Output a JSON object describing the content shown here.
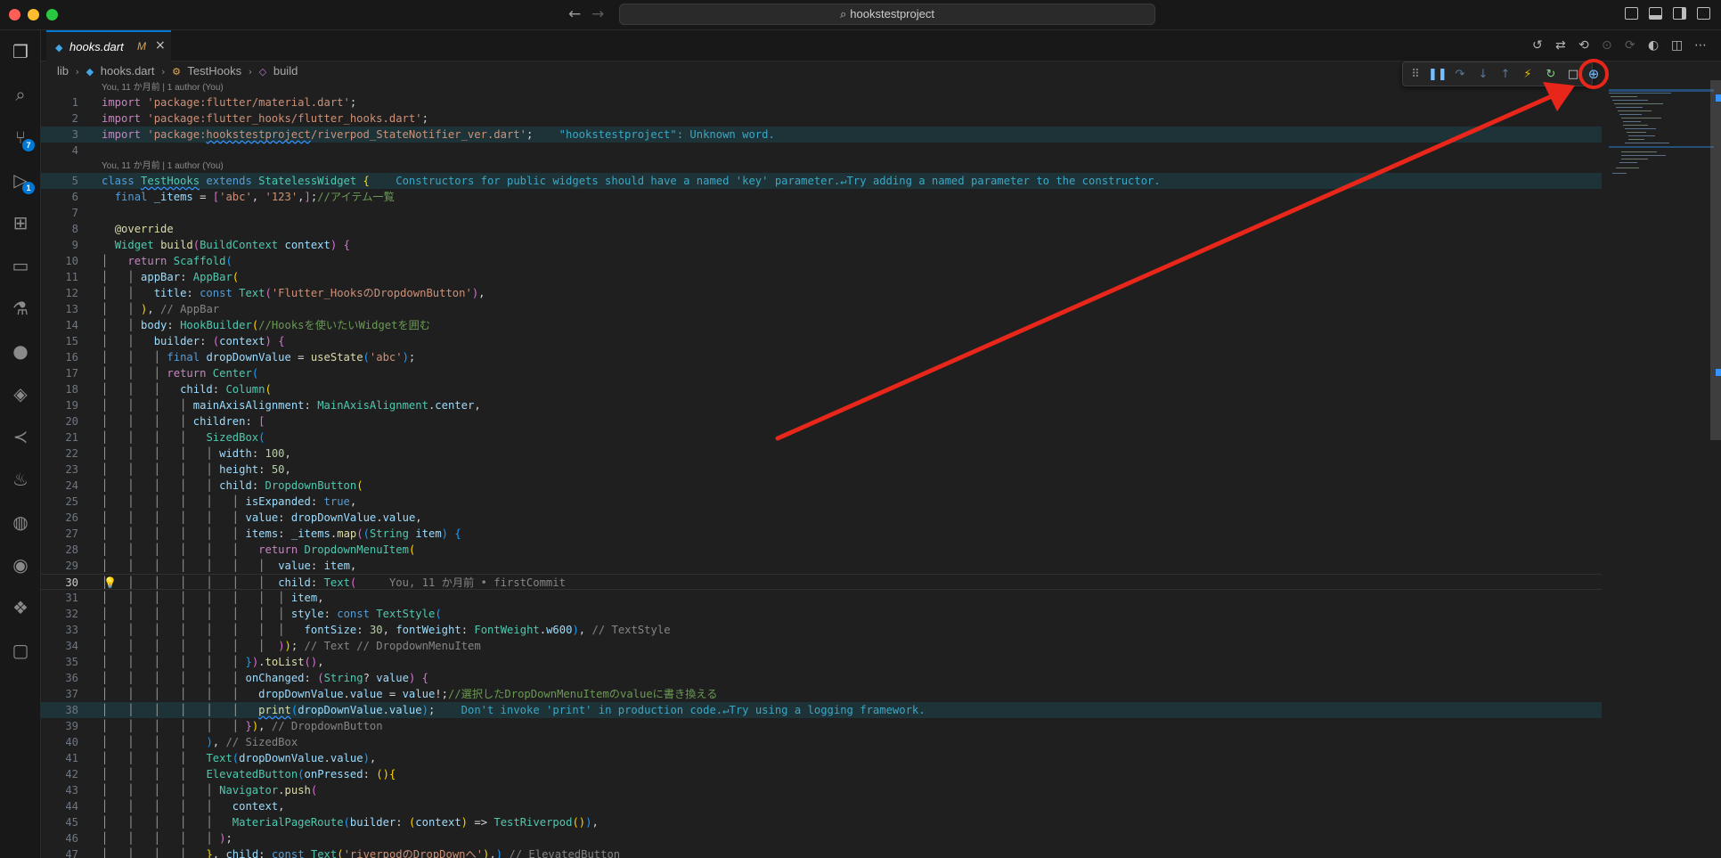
{
  "window": {
    "search_text": "hookstestproject"
  },
  "tab": {
    "label": "hooks.dart",
    "modified": "M"
  },
  "breadcrumb": [
    "lib",
    "hooks.dart",
    "TestHooks",
    "build"
  ],
  "blame": {
    "line1": "You, 11 か月前 | 1 author (You)",
    "line5": "You, 11 か月前 | 1 author (You)",
    "inline30": "You, 11 か月前 • firstCommit"
  },
  "diagnostics": {
    "line3": "\"hookstestproject\": Unknown word.",
    "line5": "Constructors for public widgets should have a named 'key' parameter.↵Try adding a named parameter to the constructor.",
    "line38": "Don't invoke 'print' in production code.↵Try using a logging framework."
  },
  "activity_badges": {
    "source_control": "7",
    "run_debug": "1"
  },
  "colors": {
    "accent": "#0078d4",
    "annotation_red": "#e8261a"
  },
  "icons": {
    "activity": [
      "explorer-icon",
      "search-icon",
      "source-control-icon",
      "run-debug-icon",
      "extensions-icon",
      "remote-explorer-icon",
      "testing-icon",
      "github-icon",
      "python-icon",
      "flutter-icon",
      "genie-icon",
      "gitlens-icon",
      "docker-icon",
      "figma-icon",
      "chat-icon"
    ],
    "debug_toolbar": [
      "drag-handle-icon",
      "pause-icon",
      "step-over-icon",
      "step-into-icon",
      "step-out-icon",
      "hot-reload-icon",
      "restart-icon",
      "stop-icon",
      "widget-inspector-icon"
    ]
  }
}
